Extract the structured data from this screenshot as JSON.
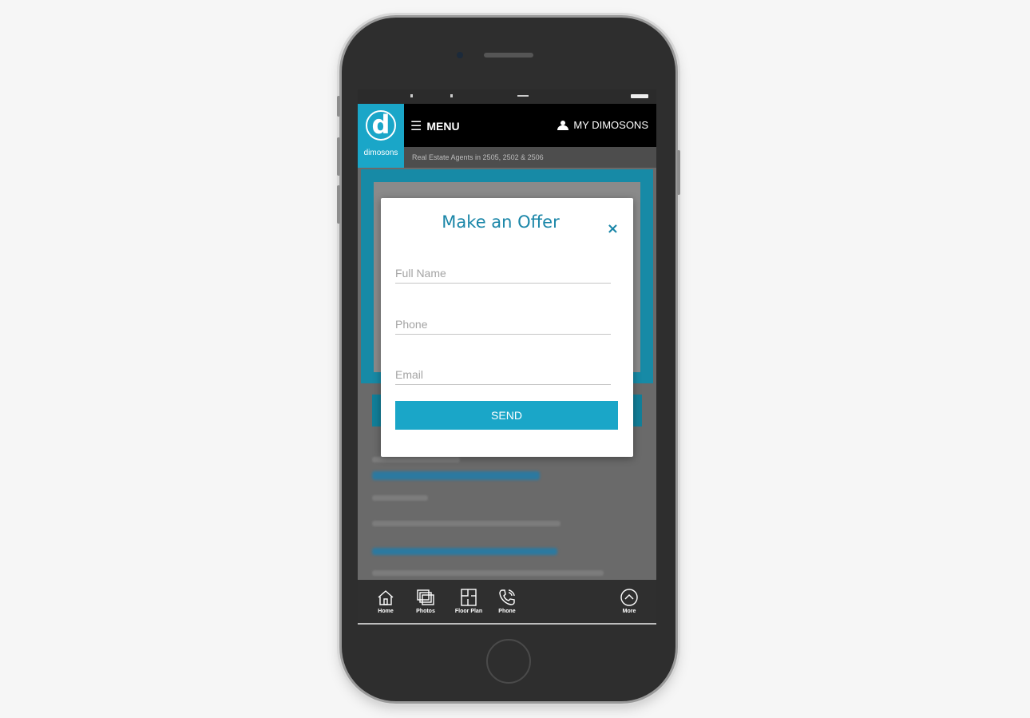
{
  "header": {
    "brand": "dimosons",
    "logo_letter": "d",
    "menu_label": "MENU",
    "account_label": "MY DIMOSONS",
    "tagline": "Real Estate Agents in 2505, 2502 & 2506"
  },
  "modal": {
    "title": "Make an Offer",
    "close_symbol": "×",
    "fields": {
      "full_name_placeholder": "Full Name",
      "phone_placeholder": "Phone",
      "email_placeholder": "Email"
    },
    "send_label": "SEND"
  },
  "bottom_nav": {
    "items": [
      {
        "label": "Home",
        "icon": "house-icon"
      },
      {
        "label": "Photos",
        "icon": "photos-icon"
      },
      {
        "label": "Floor Plan",
        "icon": "floor-plan-icon"
      },
      {
        "label": "Phone",
        "icon": "phone-icon"
      },
      {
        "label": "More",
        "icon": "chevron-up-circle-icon"
      }
    ]
  },
  "colors": {
    "accent": "#1aa6c8",
    "title_blue": "#1a86a8",
    "header_bg": "#000000"
  }
}
